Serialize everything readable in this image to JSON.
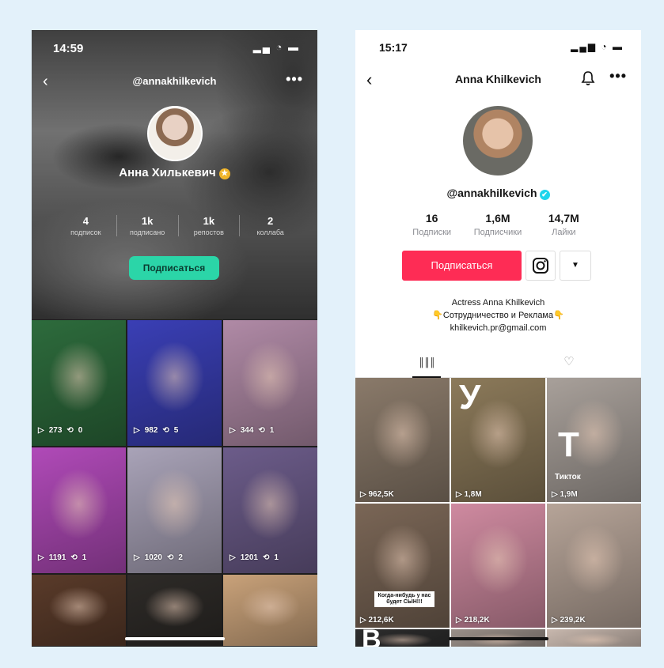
{
  "left_phone": {
    "status_time": "14:59",
    "status_icons": "▂▄ ◔ ▬",
    "back_glyph": "‹",
    "handle": "@annakhilkevich",
    "more_glyph": "•••",
    "display_name": "Анна Хилькевич",
    "badge_glyph": "★",
    "stats": [
      {
        "value": "4",
        "label": "подписок"
      },
      {
        "value": "1k",
        "label": "подписано"
      },
      {
        "value": "1k",
        "label": "репостов"
      },
      {
        "value": "2",
        "label": "коллаба"
      }
    ],
    "follow_label": "Подписаться",
    "videos": [
      {
        "views": "273",
        "reposts": "0",
        "bg": "#2d6b3c"
      },
      {
        "views": "982",
        "reposts": "5",
        "bg": "#3a3fb5"
      },
      {
        "views": "344",
        "reposts": "1",
        "bg": "#b08aa6"
      },
      {
        "views": "1191",
        "reposts": "1",
        "bg": "#b04ab8"
      },
      {
        "views": "1020",
        "reposts": "2",
        "bg": "#a9a3b8"
      },
      {
        "views": "1201",
        "reposts": "1",
        "bg": "#6c5c8a"
      },
      {
        "views": "",
        "reposts": "",
        "bg": "#5a3b2a"
      },
      {
        "views": "",
        "reposts": "",
        "bg": "#2e2b28"
      },
      {
        "views": "",
        "reposts": "",
        "bg": "#c9a27a"
      }
    ]
  },
  "right_phone": {
    "status_time": "15:17",
    "status_icons": "▂▄▆ ◔ ▬",
    "back_glyph": "‹",
    "title": "Anna Khilkevich",
    "more_glyph": "•••",
    "handle": "@annakhilkevich",
    "verified_glyph": "✔",
    "stats": [
      {
        "value": "16",
        "label": "Подписки"
      },
      {
        "value": "1,6M",
        "label": "Подписчики"
      },
      {
        "value": "14,7M",
        "label": "Лайки"
      }
    ],
    "follow_label": "Подписаться",
    "dropdown_glyph": "▼",
    "bio": [
      "Actress Anna Khilkevich",
      "👇Сотрудничество и Реклама👇",
      "khilkevich.pr@gmail.com"
    ],
    "tab_videos_glyph": "║║║",
    "tab_liked_glyph": "♡",
    "videos": [
      {
        "views": "962,5K",
        "bg": "#8a7a6a",
        "overlay": ""
      },
      {
        "views": "1,8M",
        "bg": "#8c7a5a",
        "overlay": "У"
      },
      {
        "views": "1,9M",
        "bg": "#a8a09a",
        "overlay": "Т",
        "caption": "Тикток"
      },
      {
        "views": "212,6K",
        "bg": "#7a6656",
        "overlay": "",
        "note": "Когда-нибудь у нас будет СЫН!!!"
      },
      {
        "views": "218,2K",
        "bg": "#cf8aa0",
        "overlay": ""
      },
      {
        "views": "239,2K",
        "bg": "#b6a498",
        "overlay": ""
      },
      {
        "views": "",
        "bg": "#2d2d2d",
        "overlay": "B"
      },
      {
        "views": "",
        "bg": "#9a8f88",
        "overlay": ""
      },
      {
        "views": "",
        "bg": "#c8b8ae",
        "overlay": ""
      }
    ],
    "colors": {
      "follow": "#fe2c55",
      "verified": "#20d5ec"
    }
  }
}
